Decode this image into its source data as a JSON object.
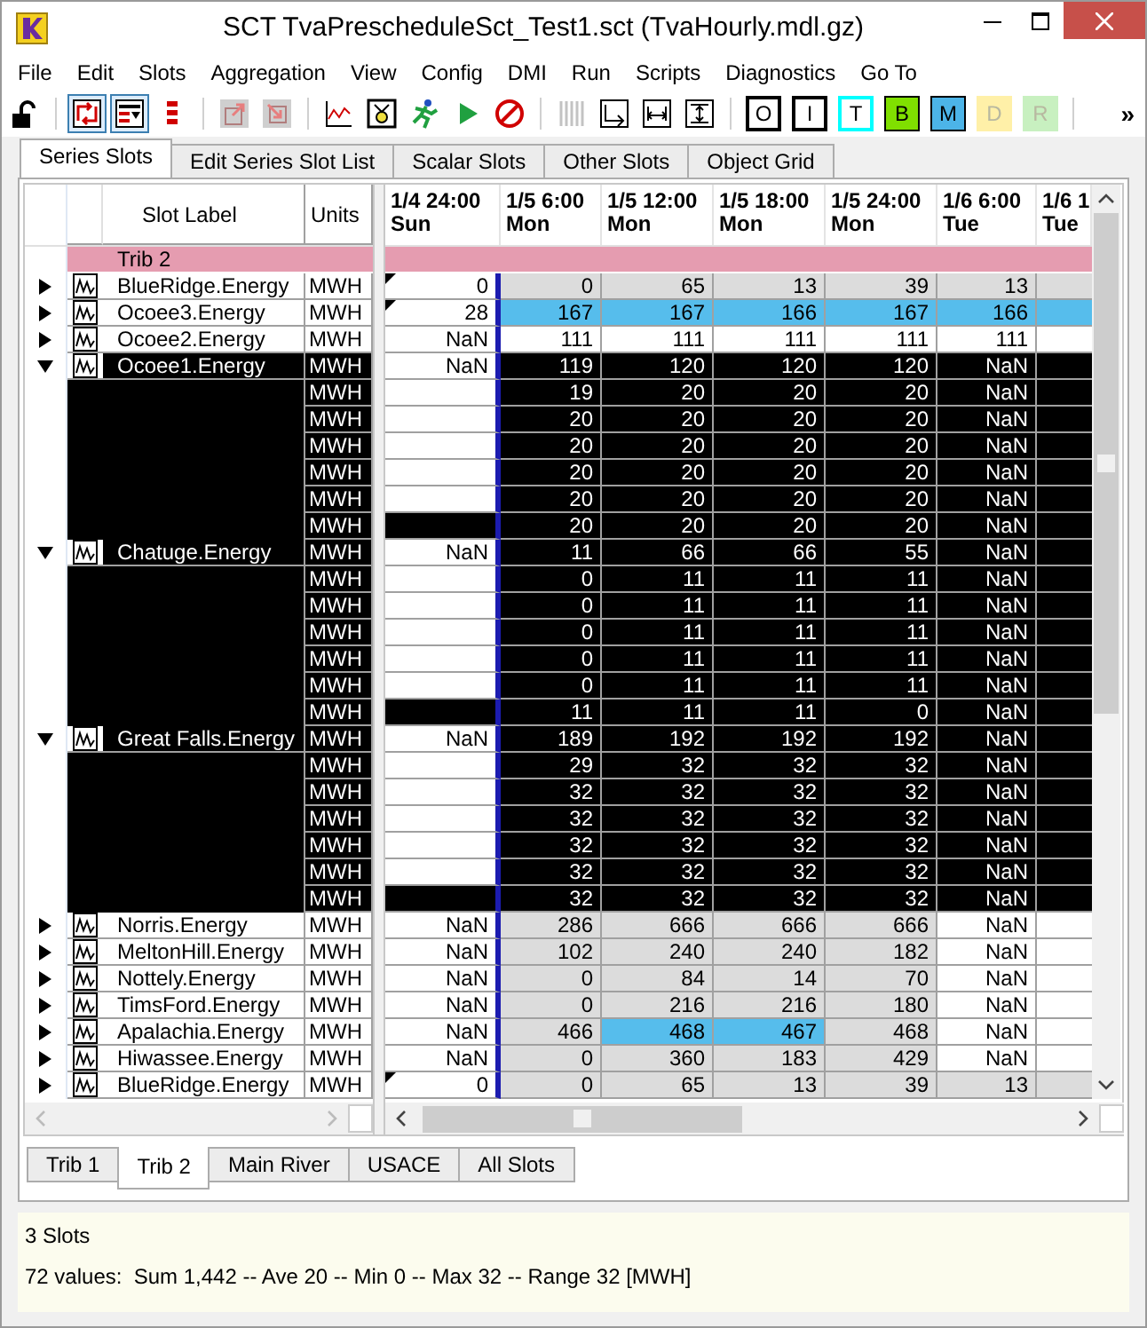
{
  "window": {
    "title": "SCT TvaPrescheduleSct_Test1.sct (TvaHourly.mdl.gz)"
  },
  "menu": [
    "File",
    "Edit",
    "Slots",
    "Aggregation",
    "View",
    "Config",
    "DMI",
    "Run",
    "Scripts",
    "Diagnostics",
    "Go To"
  ],
  "toolbar": [
    {
      "kind": "icon",
      "selected": false,
      "disabled": false
    },
    {
      "kind": "separator"
    },
    {
      "kind": "icon",
      "selected": true,
      "disabled": false
    },
    {
      "kind": "icon",
      "selected": true,
      "disabled": false
    },
    {
      "kind": "icon",
      "selected": false,
      "disabled": false
    },
    {
      "kind": "separator"
    },
    {
      "kind": "icon",
      "selected": false,
      "disabled": true
    },
    {
      "kind": "icon",
      "selected": false,
      "disabled": true
    },
    {
      "kind": "separator"
    },
    {
      "kind": "icon",
      "selected": false,
      "disabled": false
    },
    {
      "kind": "icon",
      "selected": false,
      "disabled": false
    },
    {
      "kind": "icon",
      "selected": false,
      "disabled": false
    },
    {
      "kind": "icon",
      "selected": false,
      "disabled": false
    },
    {
      "kind": "icon",
      "selected": false,
      "disabled": false
    },
    {
      "kind": "separator"
    },
    {
      "kind": "icon",
      "selected": false,
      "disabled": true
    },
    {
      "kind": "icon",
      "selected": false,
      "disabled": false
    },
    {
      "kind": "icon",
      "selected": false,
      "disabled": false
    },
    {
      "kind": "icon",
      "selected": false,
      "disabled": false
    },
    {
      "kind": "separator"
    },
    {
      "kind": "outlined",
      "label": "O",
      "color": "#000000",
      "disabled": false
    },
    {
      "kind": "outlined",
      "label": "I",
      "color": "#000000",
      "disabled": false
    },
    {
      "kind": "outlined",
      "label": "T",
      "color": "#00ffff",
      "disabled": false
    },
    {
      "kind": "filled",
      "label": "B",
      "color": "#80e000",
      "disabled": false
    },
    {
      "kind": "filled",
      "label": "M",
      "color": "#4cb4e8",
      "disabled": false
    },
    {
      "kind": "filled",
      "label": "D",
      "color": "#fff0a8",
      "disabled": true
    },
    {
      "kind": "filled",
      "label": "R",
      "color": "#c8f0c0",
      "disabled": true
    },
    {
      "kind": "separator"
    }
  ],
  "toolbar_overflow": "»",
  "tabs": [
    {
      "label": "Series Slots",
      "selected": true
    },
    {
      "label": "Edit Series Slot List",
      "selected": false
    },
    {
      "label": "Scalar Slots",
      "selected": false
    },
    {
      "label": "Other Slots",
      "selected": false
    },
    {
      "label": "Object Grid",
      "selected": false
    }
  ],
  "left_columns": [
    "Slot Label",
    "Units"
  ],
  "columns": [
    {
      "date": "1/4 24:00",
      "day": "Sun"
    },
    {
      "date": "1/5 6:00",
      "day": "Mon"
    },
    {
      "date": "1/5 12:00",
      "day": "Mon"
    },
    {
      "date": "1/5 18:00",
      "day": "Mon"
    },
    {
      "date": "1/5 24:00",
      "day": "Mon"
    },
    {
      "date": "1/6 6:00",
      "day": "Tue"
    },
    {
      "date": "1/6 1",
      "day": "Tue"
    }
  ],
  "rows": [
    {
      "kind": "group",
      "label": "Trib 2"
    },
    {
      "kind": "slot",
      "label": "BlueRidge.Energy",
      "units": "MWH",
      "expanded": false,
      "selected": false,
      "flagged": true,
      "cells": [
        {
          "value": "0",
          "color": "#ffffff"
        },
        {
          "value": "0",
          "color": "#dcdcdc"
        },
        {
          "value": "65",
          "color": "#dcdcdc"
        },
        {
          "value": "13",
          "color": "#dcdcdc"
        },
        {
          "value": "39",
          "color": "#dcdcdc"
        },
        {
          "value": "13",
          "color": "#dcdcdc"
        },
        {
          "color": "#dcdcdc"
        }
      ]
    },
    {
      "kind": "slot",
      "label": "Ocoee3.Energy",
      "units": "MWH",
      "expanded": false,
      "selected": false,
      "flagged": true,
      "cells": [
        {
          "value": "28",
          "color": "#ffffff"
        },
        {
          "value": "167",
          "color": "#56bdec"
        },
        {
          "value": "167",
          "color": "#56bdec"
        },
        {
          "value": "166",
          "color": "#56bdec"
        },
        {
          "value": "167",
          "color": "#56bdec"
        },
        {
          "value": "166",
          "color": "#56bdec"
        },
        {
          "color": "#56bdec"
        }
      ]
    },
    {
      "kind": "slot",
      "label": "Ocoee2.Energy",
      "units": "MWH",
      "expanded": false,
      "selected": false,
      "flagged": false,
      "cells": [
        {
          "value": "NaN",
          "color": "#ffffff"
        },
        {
          "value": "111",
          "color": "#ffffff"
        },
        {
          "value": "111",
          "color": "#ffffff"
        },
        {
          "value": "111",
          "color": "#ffffff"
        },
        {
          "value": "111",
          "color": "#ffffff"
        },
        {
          "value": "111",
          "color": "#ffffff"
        },
        {
          "color": "#ffffff"
        }
      ]
    },
    {
      "kind": "slot",
      "label": "Ocoee1.Energy",
      "units": "MWH",
      "expanded": true,
      "selected": true,
      "flagged": false,
      "cells": [
        {
          "value": "NaN",
          "color": "#ffffff"
        },
        {
          "value": "119",
          "color": "#000000"
        },
        {
          "value": "120",
          "color": "#000000"
        },
        {
          "value": "120",
          "color": "#000000"
        },
        {
          "value": "120",
          "color": "#000000"
        },
        {
          "value": "NaN",
          "color": "#000000"
        },
        {
          "color": "#000000"
        }
      ],
      "children": [
        {
          "units": "MWH",
          "cells": [
            {
              "color": "#ffffff"
            },
            {
              "value": "19",
              "color": "#000000"
            },
            {
              "value": "20",
              "color": "#000000"
            },
            {
              "value": "20",
              "color": "#000000"
            },
            {
              "value": "20",
              "color": "#000000"
            },
            {
              "value": "NaN",
              "color": "#000000"
            },
            {
              "color": "#000000"
            }
          ]
        },
        {
          "units": "MWH",
          "cells": [
            {
              "color": "#ffffff"
            },
            {
              "value": "20",
              "color": "#000000"
            },
            {
              "value": "20",
              "color": "#000000"
            },
            {
              "value": "20",
              "color": "#000000"
            },
            {
              "value": "20",
              "color": "#000000"
            },
            {
              "value": "NaN",
              "color": "#000000"
            },
            {
              "color": "#000000"
            }
          ]
        },
        {
          "units": "MWH",
          "cells": [
            {
              "color": "#ffffff"
            },
            {
              "value": "20",
              "color": "#000000"
            },
            {
              "value": "20",
              "color": "#000000"
            },
            {
              "value": "20",
              "color": "#000000"
            },
            {
              "value": "20",
              "color": "#000000"
            },
            {
              "value": "NaN",
              "color": "#000000"
            },
            {
              "color": "#000000"
            }
          ]
        },
        {
          "units": "MWH",
          "cells": [
            {
              "color": "#ffffff"
            },
            {
              "value": "20",
              "color": "#000000"
            },
            {
              "value": "20",
              "color": "#000000"
            },
            {
              "value": "20",
              "color": "#000000"
            },
            {
              "value": "20",
              "color": "#000000"
            },
            {
              "value": "NaN",
              "color": "#000000"
            },
            {
              "color": "#000000"
            }
          ]
        },
        {
          "units": "MWH",
          "cells": [
            {
              "color": "#ffffff"
            },
            {
              "value": "20",
              "color": "#000000"
            },
            {
              "value": "20",
              "color": "#000000"
            },
            {
              "value": "20",
              "color": "#000000"
            },
            {
              "value": "20",
              "color": "#000000"
            },
            {
              "value": "NaN",
              "color": "#000000"
            },
            {
              "color": "#000000"
            }
          ]
        },
        {
          "units": "MWH",
          "cells": [
            {
              "color": "#000000"
            },
            {
              "value": "20",
              "color": "#000000"
            },
            {
              "value": "20",
              "color": "#000000"
            },
            {
              "value": "20",
              "color": "#000000"
            },
            {
              "value": "20",
              "color": "#000000"
            },
            {
              "value": "NaN",
              "color": "#000000"
            },
            {
              "color": "#000000"
            }
          ]
        }
      ]
    },
    {
      "kind": "slot",
      "label": "Chatuge.Energy",
      "units": "MWH",
      "expanded": true,
      "selected": true,
      "flagged": false,
      "cells": [
        {
          "value": "NaN",
          "color": "#ffffff"
        },
        {
          "value": "11",
          "color": "#000000"
        },
        {
          "value": "66",
          "color": "#000000"
        },
        {
          "value": "66",
          "color": "#000000"
        },
        {
          "value": "55",
          "color": "#000000"
        },
        {
          "value": "NaN",
          "color": "#000000"
        },
        {
          "color": "#000000"
        }
      ],
      "children": [
        {
          "units": "MWH",
          "cells": [
            {
              "color": "#ffffff"
            },
            {
              "value": "0",
              "color": "#000000"
            },
            {
              "value": "11",
              "color": "#000000"
            },
            {
              "value": "11",
              "color": "#000000"
            },
            {
              "value": "11",
              "color": "#000000"
            },
            {
              "value": "NaN",
              "color": "#000000"
            },
            {
              "color": "#000000"
            }
          ]
        },
        {
          "units": "MWH",
          "cells": [
            {
              "color": "#ffffff"
            },
            {
              "value": "0",
              "color": "#000000"
            },
            {
              "value": "11",
              "color": "#000000"
            },
            {
              "value": "11",
              "color": "#000000"
            },
            {
              "value": "11",
              "color": "#000000"
            },
            {
              "value": "NaN",
              "color": "#000000"
            },
            {
              "color": "#000000"
            }
          ]
        },
        {
          "units": "MWH",
          "cells": [
            {
              "color": "#ffffff"
            },
            {
              "value": "0",
              "color": "#000000"
            },
            {
              "value": "11",
              "color": "#000000"
            },
            {
              "value": "11",
              "color": "#000000"
            },
            {
              "value": "11",
              "color": "#000000"
            },
            {
              "value": "NaN",
              "color": "#000000"
            },
            {
              "color": "#000000"
            }
          ]
        },
        {
          "units": "MWH",
          "cells": [
            {
              "color": "#ffffff"
            },
            {
              "value": "0",
              "color": "#000000"
            },
            {
              "value": "11",
              "color": "#000000"
            },
            {
              "value": "11",
              "color": "#000000"
            },
            {
              "value": "11",
              "color": "#000000"
            },
            {
              "value": "NaN",
              "color": "#000000"
            },
            {
              "color": "#000000"
            }
          ]
        },
        {
          "units": "MWH",
          "cells": [
            {
              "color": "#ffffff"
            },
            {
              "value": "0",
              "color": "#000000"
            },
            {
              "value": "11",
              "color": "#000000"
            },
            {
              "value": "11",
              "color": "#000000"
            },
            {
              "value": "11",
              "color": "#000000"
            },
            {
              "value": "NaN",
              "color": "#000000"
            },
            {
              "color": "#000000"
            }
          ]
        },
        {
          "units": "MWH",
          "cells": [
            {
              "color": "#000000"
            },
            {
              "value": "11",
              "color": "#000000"
            },
            {
              "value": "11",
              "color": "#000000"
            },
            {
              "value": "11",
              "color": "#000000"
            },
            {
              "value": "0",
              "color": "#000000"
            },
            {
              "value": "NaN",
              "color": "#000000"
            },
            {
              "color": "#000000"
            }
          ]
        }
      ]
    },
    {
      "kind": "slot",
      "label": "Great Falls.Energy",
      "units": "MWH",
      "expanded": true,
      "selected": true,
      "flagged": false,
      "cells": [
        {
          "value": "NaN",
          "color": "#ffffff"
        },
        {
          "value": "189",
          "color": "#000000"
        },
        {
          "value": "192",
          "color": "#000000"
        },
        {
          "value": "192",
          "color": "#000000"
        },
        {
          "value": "192",
          "color": "#000000"
        },
        {
          "value": "NaN",
          "color": "#000000"
        },
        {
          "color": "#000000"
        }
      ],
      "children": [
        {
          "units": "MWH",
          "cells": [
            {
              "color": "#ffffff"
            },
            {
              "value": "29",
              "color": "#000000"
            },
            {
              "value": "32",
              "color": "#000000"
            },
            {
              "value": "32",
              "color": "#000000"
            },
            {
              "value": "32",
              "color": "#000000"
            },
            {
              "value": "NaN",
              "color": "#000000"
            },
            {
              "color": "#000000"
            }
          ]
        },
        {
          "units": "MWH",
          "cells": [
            {
              "color": "#ffffff"
            },
            {
              "value": "32",
              "color": "#000000"
            },
            {
              "value": "32",
              "color": "#000000"
            },
            {
              "value": "32",
              "color": "#000000"
            },
            {
              "value": "32",
              "color": "#000000"
            },
            {
              "value": "NaN",
              "color": "#000000"
            },
            {
              "color": "#000000"
            }
          ]
        },
        {
          "units": "MWH",
          "cells": [
            {
              "color": "#ffffff"
            },
            {
              "value": "32",
              "color": "#000000"
            },
            {
              "value": "32",
              "color": "#000000"
            },
            {
              "value": "32",
              "color": "#000000"
            },
            {
              "value": "32",
              "color": "#000000"
            },
            {
              "value": "NaN",
              "color": "#000000"
            },
            {
              "color": "#000000"
            }
          ]
        },
        {
          "units": "MWH",
          "cells": [
            {
              "color": "#ffffff"
            },
            {
              "value": "32",
              "color": "#000000"
            },
            {
              "value": "32",
              "color": "#000000"
            },
            {
              "value": "32",
              "color": "#000000"
            },
            {
              "value": "32",
              "color": "#000000"
            },
            {
              "value": "NaN",
              "color": "#000000"
            },
            {
              "color": "#000000"
            }
          ]
        },
        {
          "units": "MWH",
          "cells": [
            {
              "color": "#ffffff"
            },
            {
              "value": "32",
              "color": "#000000"
            },
            {
              "value": "32",
              "color": "#000000"
            },
            {
              "value": "32",
              "color": "#000000"
            },
            {
              "value": "32",
              "color": "#000000"
            },
            {
              "value": "NaN",
              "color": "#000000"
            },
            {
              "color": "#000000"
            }
          ]
        },
        {
          "units": "MWH",
          "cells": [
            {
              "color": "#000000"
            },
            {
              "value": "32",
              "color": "#000000"
            },
            {
              "value": "32",
              "color": "#000000"
            },
            {
              "value": "32",
              "color": "#000000"
            },
            {
              "value": "32",
              "color": "#000000"
            },
            {
              "value": "NaN",
              "color": "#000000"
            },
            {
              "color": "#000000"
            }
          ]
        }
      ]
    },
    {
      "kind": "slot",
      "label": "Norris.Energy",
      "units": "MWH",
      "expanded": false,
      "selected": false,
      "flagged": false,
      "cells": [
        {
          "value": "NaN",
          "color": "#ffffff"
        },
        {
          "value": "286",
          "color": "#dcdcdc"
        },
        {
          "value": "666",
          "color": "#dcdcdc"
        },
        {
          "value": "666",
          "color": "#dcdcdc"
        },
        {
          "value": "666",
          "color": "#dcdcdc"
        },
        {
          "value": "NaN",
          "color": "#ffffff"
        },
        {
          "color": "#ffffff"
        }
      ]
    },
    {
      "kind": "slot",
      "label": "MeltonHill.Energy",
      "units": "MWH",
      "expanded": false,
      "selected": false,
      "flagged": false,
      "cells": [
        {
          "value": "NaN",
          "color": "#ffffff"
        },
        {
          "value": "102",
          "color": "#dcdcdc"
        },
        {
          "value": "240",
          "color": "#dcdcdc"
        },
        {
          "value": "240",
          "color": "#dcdcdc"
        },
        {
          "value": "182",
          "color": "#dcdcdc"
        },
        {
          "value": "NaN",
          "color": "#ffffff"
        },
        {
          "color": "#ffffff"
        }
      ]
    },
    {
      "kind": "slot",
      "label": "Nottely.Energy",
      "units": "MWH",
      "expanded": false,
      "selected": false,
      "flagged": false,
      "cells": [
        {
          "value": "NaN",
          "color": "#ffffff"
        },
        {
          "value": "0",
          "color": "#dcdcdc"
        },
        {
          "value": "84",
          "color": "#dcdcdc"
        },
        {
          "value": "14",
          "color": "#dcdcdc"
        },
        {
          "value": "70",
          "color": "#dcdcdc"
        },
        {
          "value": "NaN",
          "color": "#ffffff"
        },
        {
          "color": "#ffffff"
        }
      ]
    },
    {
      "kind": "slot",
      "label": "TimsFord.Energy",
      "units": "MWH",
      "expanded": false,
      "selected": false,
      "flagged": false,
      "cells": [
        {
          "value": "NaN",
          "color": "#ffffff"
        },
        {
          "value": "0",
          "color": "#dcdcdc"
        },
        {
          "value": "216",
          "color": "#dcdcdc"
        },
        {
          "value": "216",
          "color": "#dcdcdc"
        },
        {
          "value": "180",
          "color": "#dcdcdc"
        },
        {
          "value": "NaN",
          "color": "#ffffff"
        },
        {
          "color": "#ffffff"
        }
      ]
    },
    {
      "kind": "slot",
      "label": "Apalachia.Energy",
      "units": "MWH",
      "expanded": false,
      "selected": false,
      "flagged": false,
      "cells": [
        {
          "value": "NaN",
          "color": "#ffffff"
        },
        {
          "value": "466",
          "color": "#dcdcdc"
        },
        {
          "value": "468",
          "color": "#56bdec"
        },
        {
          "value": "467",
          "color": "#56bdec"
        },
        {
          "value": "468",
          "color": "#dcdcdc"
        },
        {
          "value": "NaN",
          "color": "#ffffff"
        },
        {
          "color": "#ffffff"
        }
      ]
    },
    {
      "kind": "slot",
      "label": "Hiwassee.Energy",
      "units": "MWH",
      "expanded": false,
      "selected": false,
      "flagged": false,
      "cells": [
        {
          "value": "NaN",
          "color": "#ffffff"
        },
        {
          "value": "0",
          "color": "#dcdcdc"
        },
        {
          "value": "360",
          "color": "#dcdcdc"
        },
        {
          "value": "183",
          "color": "#dcdcdc"
        },
        {
          "value": "429",
          "color": "#dcdcdc"
        },
        {
          "value": "NaN",
          "color": "#ffffff"
        },
        {
          "color": "#ffffff"
        }
      ]
    },
    {
      "kind": "slot",
      "label": "BlueRidge.Energy",
      "units": "MWH",
      "expanded": false,
      "selected": false,
      "flagged": true,
      "cells": [
        {
          "value": "0",
          "color": "#ffffff"
        },
        {
          "value": "0",
          "color": "#dcdcdc"
        },
        {
          "value": "65",
          "color": "#dcdcdc"
        },
        {
          "value": "13",
          "color": "#dcdcdc"
        },
        {
          "value": "39",
          "color": "#dcdcdc"
        },
        {
          "value": "13",
          "color": "#dcdcdc"
        },
        {
          "color": "#dcdcdc"
        }
      ]
    }
  ],
  "sheet_tabs": [
    {
      "label": "Trib 1",
      "selected": false
    },
    {
      "label": "Trib 2",
      "selected": true
    },
    {
      "label": "Main River",
      "selected": false
    },
    {
      "label": "USACE",
      "selected": false
    },
    {
      "label": "All Slots",
      "selected": false
    }
  ],
  "status": {
    "selection": "3 Slots",
    "summary": "72 values:  Sum 1,442 -- Ave 20 -- Min 0 -- Max 32 -- Range 32 [MWH]"
  }
}
